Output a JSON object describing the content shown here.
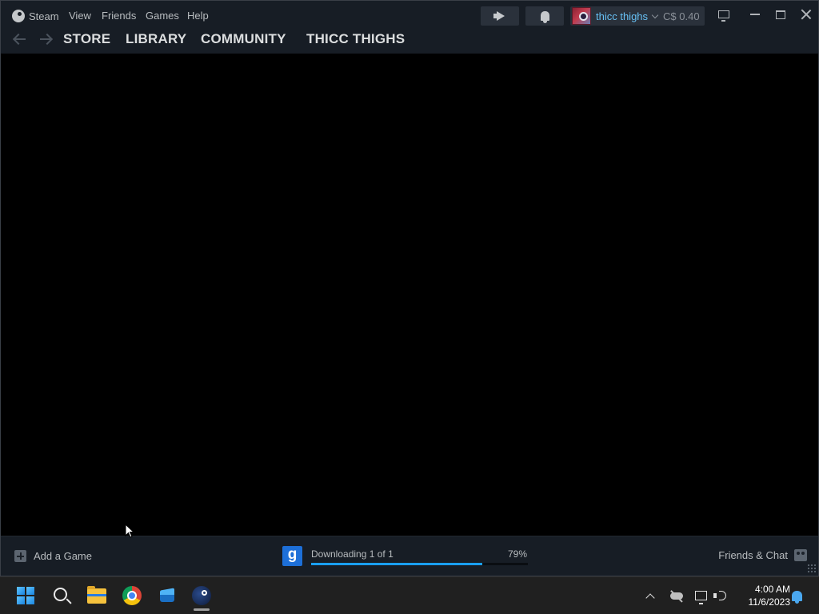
{
  "titlebar": {
    "app_menu": "Steam",
    "menu": [
      "View",
      "Friends",
      "Games",
      "Help"
    ],
    "account": {
      "name": "thicc thighs",
      "wallet": "C$ 0.40"
    }
  },
  "nav": {
    "tabs": [
      "STORE",
      "LIBRARY",
      "COMMUNITY",
      "THICC THIGHS"
    ]
  },
  "bottombar": {
    "add_game": "Add a Game",
    "download": {
      "game_icon_letter": "g",
      "status": "Downloading 1 of 1",
      "percent_label": "79%",
      "progress": 0.79
    },
    "friends_chat": "Friends & Chat"
  },
  "taskbar": {
    "apps": [
      "windows-start-icon",
      "search-icon",
      "file-explorer-icon",
      "chrome-icon",
      "box-app-icon",
      "steam-icon"
    ],
    "clock": {
      "time": "4:00 AM",
      "date": "11/6/2023"
    }
  },
  "colors": {
    "accent": "#1a9fff",
    "account_name": "#67c1f5",
    "titlebar_bg": "#171d25"
  }
}
